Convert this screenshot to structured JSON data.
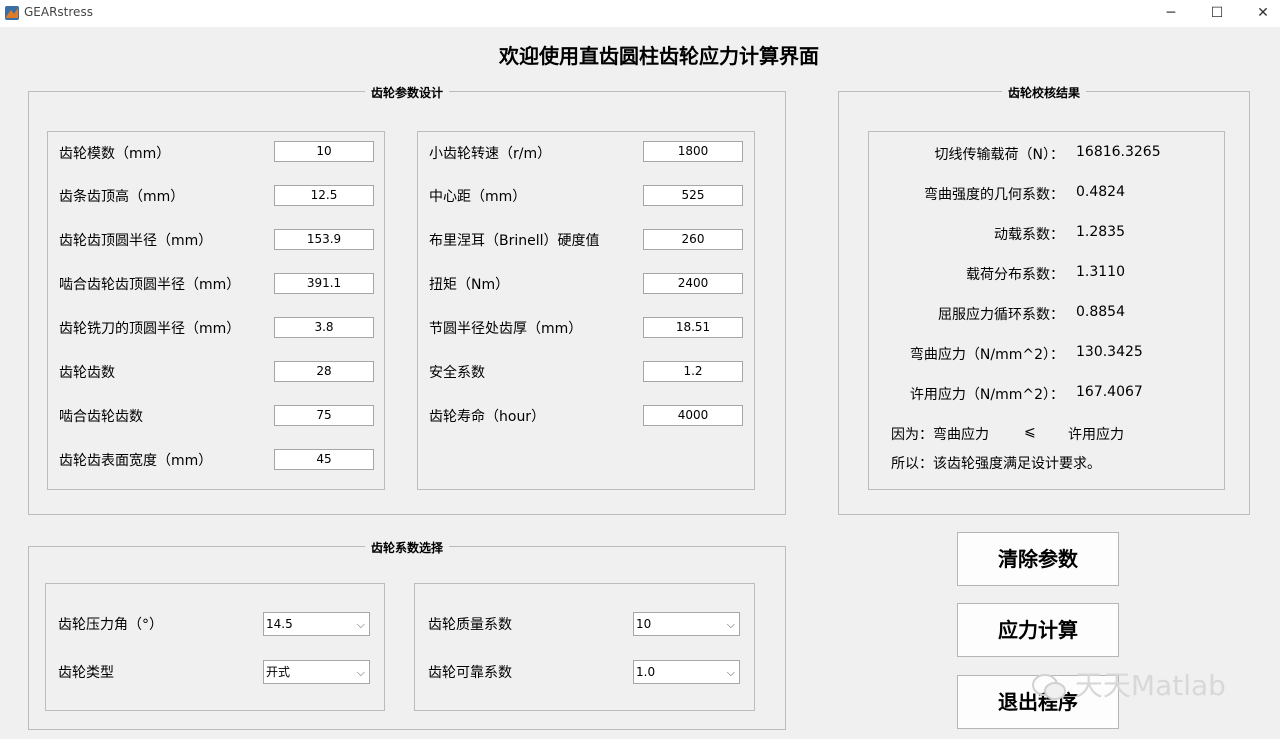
{
  "window": {
    "title": "GEARstress",
    "controls": [
      "─",
      "☐",
      "✕"
    ]
  },
  "main_title": "欢迎使用直齿圆柱齿轮应力计算界面",
  "param_panel": {
    "title": "齿轮参数设计",
    "left": [
      {
        "label": "齿轮模数（mm）",
        "value": "10"
      },
      {
        "label": "齿条齿顶高（mm）",
        "value": "12.5"
      },
      {
        "label": "齿轮齿顶圆半径（mm）",
        "value": "153.9"
      },
      {
        "label": "啮合齿轮齿顶圆半径（mm）",
        "value": "391.1"
      },
      {
        "label": "齿轮铣刀的顶圆半径（mm）",
        "value": "3.8"
      },
      {
        "label": "齿轮齿数",
        "value": "28"
      },
      {
        "label": "啮合齿轮齿数",
        "value": "75"
      },
      {
        "label": "齿轮齿表面宽度（mm）",
        "value": "45"
      }
    ],
    "right": [
      {
        "label": "小齿轮转速（r/m）",
        "value": "1800"
      },
      {
        "label": "中心距（mm）",
        "value": "525"
      },
      {
        "label": "布里涅耳（Brinell）硬度值",
        "value": "260"
      },
      {
        "label": "扭矩（Nm）",
        "value": "2400"
      },
      {
        "label": "节圆半径处齿厚（mm）",
        "value": "18.51"
      },
      {
        "label": "安全系数",
        "value": "1.2"
      },
      {
        "label": "齿轮寿命（hour）",
        "value": "4000"
      }
    ]
  },
  "coef_panel": {
    "title": "齿轮系数选择",
    "left": [
      {
        "label": "齿轮压力角（°）",
        "value": "14.5"
      },
      {
        "label": "齿轮类型",
        "value": "开式"
      }
    ],
    "right": [
      {
        "label": "齿轮质量系数",
        "value": "10"
      },
      {
        "label": "齿轮可靠系数",
        "value": "1.0"
      }
    ]
  },
  "result_panel": {
    "title": "齿轮校核结果",
    "rows": [
      {
        "label": "切线传输载荷（N）：",
        "value": "16816.3265"
      },
      {
        "label": "弯曲强度的几何系数：",
        "value": "0.4824"
      },
      {
        "label": "动载系数：",
        "value": "1.2835"
      },
      {
        "label": "载荷分布系数：",
        "value": "1.3110"
      },
      {
        "label": "屈服应力循环系数：",
        "value": "0.8854"
      },
      {
        "label": "弯曲应力（N/mm^2）：",
        "value": "130.3425"
      },
      {
        "label": "许用应力（N/mm^2）：",
        "value": "167.4067"
      }
    ],
    "because": "因为：弯曲应力",
    "relation": "⩽",
    "allowable": "许用应力",
    "conclusion": "所以：该齿轮强度满足设计要求。"
  },
  "buttons": {
    "clear": "清除参数",
    "compute": "应力计算",
    "exit": "退出程序"
  },
  "watermark": "天天Matlab"
}
